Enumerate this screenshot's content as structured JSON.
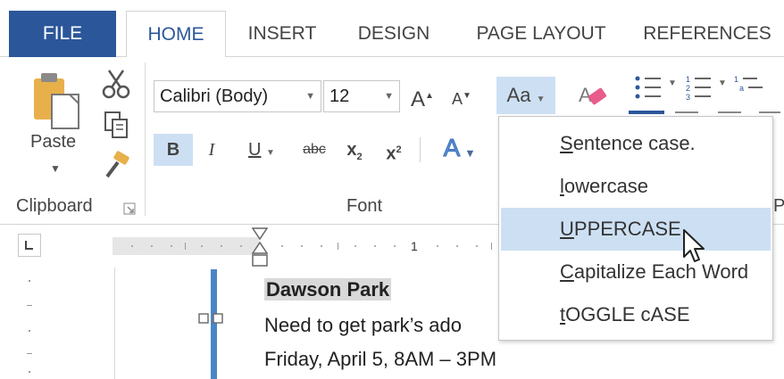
{
  "tabs": [
    {
      "label": "FILE"
    },
    {
      "label": "HOME"
    },
    {
      "label": "INSERT"
    },
    {
      "label": "DESIGN"
    },
    {
      "label": "PAGE LAYOUT"
    },
    {
      "label": "REFERENCES"
    }
  ],
  "clipboard": {
    "paste_label": "Paste",
    "group_label": "Clipboard"
  },
  "font": {
    "font_name": "Calibri (Body)",
    "font_size": "12",
    "change_case_label": "Aa",
    "bold": "B",
    "italic": "I",
    "underline": "U",
    "strikethrough": "abc",
    "subscript_base": "x",
    "subscript_mark": "2",
    "superscript_base": "x",
    "superscript_mark": "2",
    "grow_font": "A",
    "shrink_font": "A",
    "text_effects": "A",
    "group_label": "Font"
  },
  "paragraph": {
    "group_label_partial": "P"
  },
  "change_case_menu": {
    "items": [
      {
        "first": "S",
        "rest": "entence case."
      },
      {
        "first": "l",
        "rest": "owercase"
      },
      {
        "first": "U",
        "rest": "PPERCASE"
      },
      {
        "first": "C",
        "rest": "apitalize Each Word"
      },
      {
        "first": "t",
        "rest": "OGGLE cASE"
      }
    ],
    "hovered_index": 2
  },
  "ruler": {
    "marker": "1"
  },
  "document": {
    "lines": [
      "Dawson Park",
      "Need to get park’s ado",
      "Friday,  April 5, 8AM – 3PM"
    ]
  },
  "colors": {
    "file_tab": "#2b579a",
    "accent_text": "#2b579a",
    "hover_bg": "#cde0f3",
    "paragraph_bar": "#4a86c7"
  },
  "icons": [
    "paste-icon",
    "cut-icon",
    "copy-icon",
    "format-painter-icon",
    "clear-formatting-icon",
    "bullets-icon",
    "numbering-icon",
    "multilevel-list-icon",
    "dialog-launcher-icon",
    "mouse-cursor-icon"
  ]
}
